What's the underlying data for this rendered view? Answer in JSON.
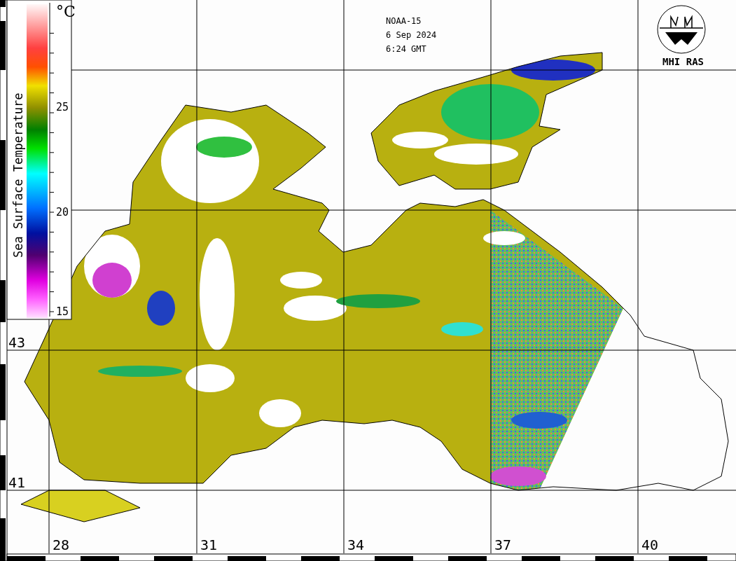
{
  "header": {
    "satellite": "NOAA-15",
    "date": "6 Sep 2024",
    "time": "6:24 GMT"
  },
  "logo": {
    "label": "MHI RAS"
  },
  "legend": {
    "title": "Sea Surface Temperature",
    "unit": "°C",
    "ticks": [
      "25",
      "20",
      "15"
    ]
  },
  "latitude_labels": [
    "43",
    "41"
  ],
  "longitude_labels": [
    "28",
    "31",
    "34",
    "37",
    "40"
  ]
}
